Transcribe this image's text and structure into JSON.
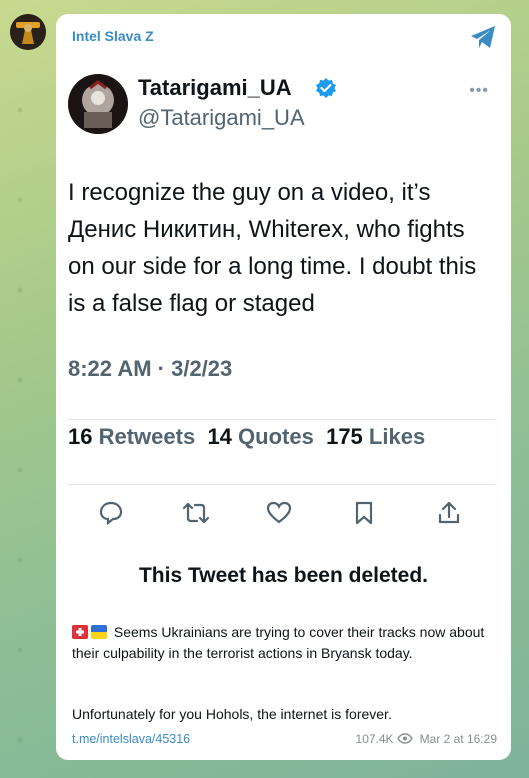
{
  "channel": {
    "name": "Intel Slava Z"
  },
  "tweet": {
    "display_name": "Tatarigami_UA",
    "handle": "@Tatarigami_UA",
    "text": "I recognize the guy on a video, it’s Денис Никитин, Whiterex, who fights on our side for a long time. I doubt this is a false flag or staged",
    "timestamp": "8:22 AM · 3/2/23",
    "retweets_count": "16",
    "retweets_label": "Retweets",
    "quotes_count": "14",
    "quotes_label": "Quotes",
    "likes_count": "175",
    "likes_label": "Likes"
  },
  "post": {
    "deleted_text": "This Tweet has been deleted.",
    "caption_line1": "Seems Ukrainians are trying to cover their tracks now about their culpability in the terrorist actions in Bryansk today.",
    "caption_line2": "Unfortunately for you Hohols, the internet is forever.",
    "link": "t.me/intelslava/45316",
    "views": "107.4K",
    "date": "Mar 2 at 16:29"
  },
  "colors": {
    "accent": "#3a8cc7",
    "verified": "#1d9bf0"
  },
  "icons": [
    "telegram-share-icon",
    "verified-badge-icon",
    "more-icon",
    "reply-icon",
    "retweet-icon",
    "like-icon",
    "bookmark-icon",
    "share-icon",
    "eye-icon",
    "swiss-flag-icon",
    "ukraine-flag-icon"
  ]
}
